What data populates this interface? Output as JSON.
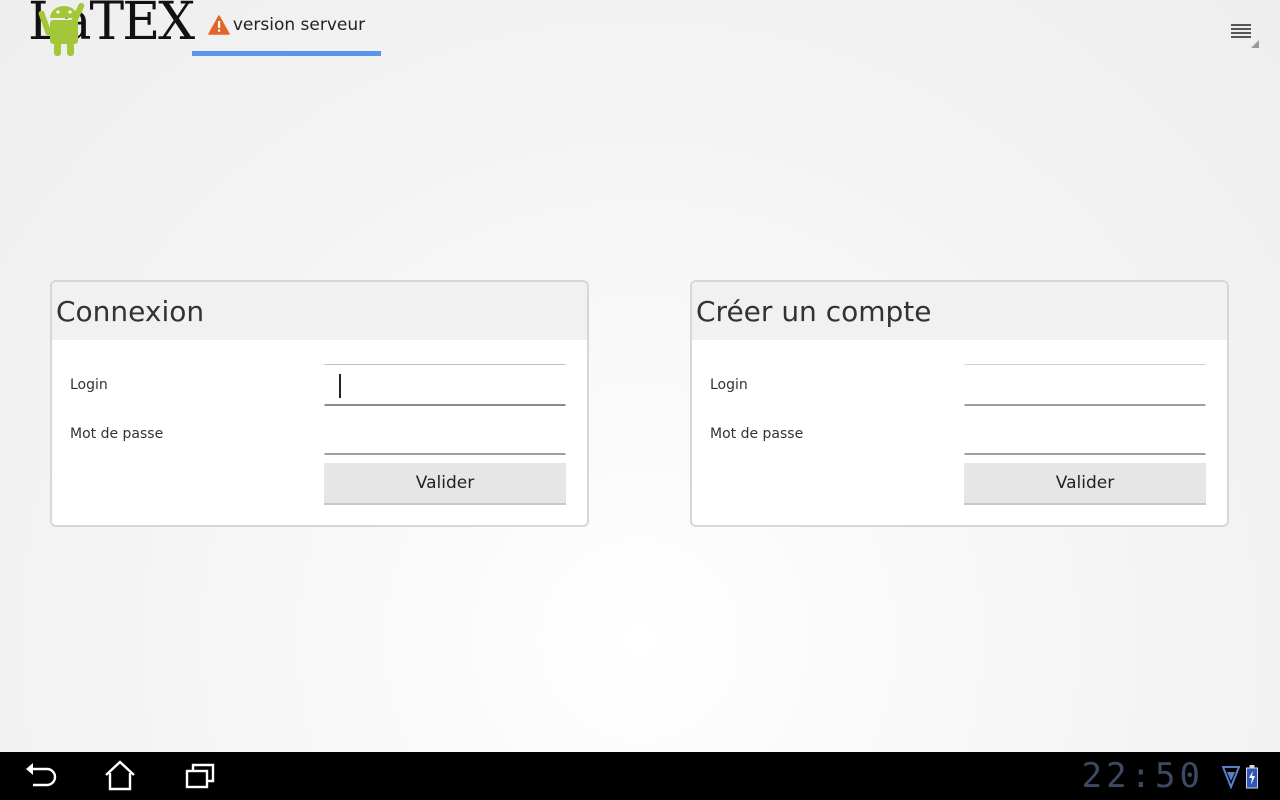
{
  "app": {
    "logo_text": "LaTEX",
    "tab_label": "version serveur"
  },
  "login_panel": {
    "title": "Connexion",
    "login_label": "Login",
    "password_label": "Mot de passe",
    "login_value": "",
    "password_value": "",
    "submit_label": "Valider"
  },
  "signup_panel": {
    "title": "Créer un compte",
    "login_label": "Login",
    "password_label": "Mot de passe",
    "login_value": "",
    "password_value": "",
    "submit_label": "Valider"
  },
  "system_bar": {
    "clock": "22:50"
  },
  "colors": {
    "tab_indicator": "#5a95f0",
    "warning": "#e2662a",
    "android_green": "#a4c639"
  },
  "icons": {
    "tab": "warning-icon",
    "menu": "overflow-menu-icon",
    "nav": [
      "back-icon",
      "home-icon",
      "recent-apps-icon"
    ],
    "status": [
      "wifi-icon",
      "battery-icon"
    ]
  }
}
